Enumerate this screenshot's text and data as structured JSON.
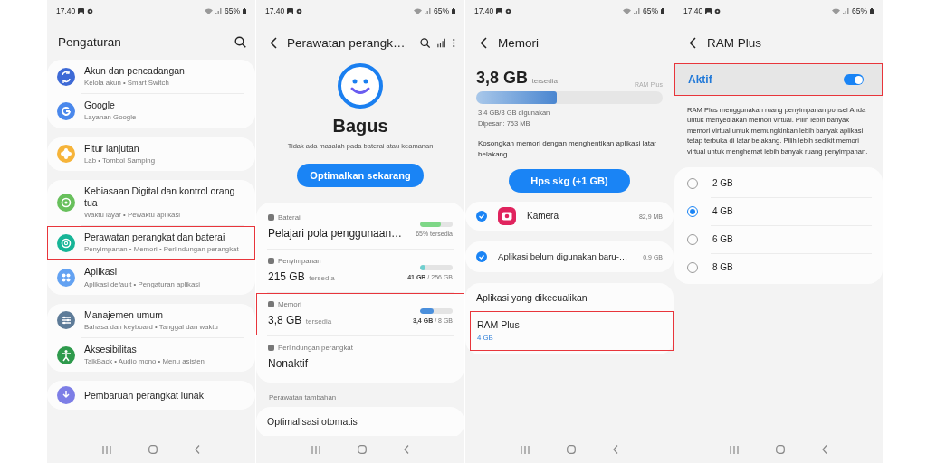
{
  "screens": [
    {
      "kind": "settings",
      "status_bar": {
        "time": "17.40",
        "battery": "65%"
      },
      "title": "Pengaturan",
      "groups": [
        {
          "items": [
            {
              "title": "Akun dan pencadangan",
              "subtitle": "Kelola akun • Smart Switch",
              "color": "#3e6ad6",
              "highlighted": false
            },
            {
              "title": "Google",
              "subtitle": "Layanan Google",
              "color": "#4a88ec",
              "highlighted": false
            }
          ]
        },
        {
          "items": [
            {
              "title": "Fitur lanjutan",
              "subtitle": "Lab • Tombol Samping",
              "color": "#f6b43a",
              "highlighted": false
            }
          ]
        },
        {
          "items": [
            {
              "title": "Kebiasaan Digital dan kontrol orang tua",
              "subtitle": "Waktu layar • Pewaktu aplikasi",
              "color": "#68c05c",
              "highlighted": false
            },
            {
              "title": "Perawatan perangkat dan baterai",
              "subtitle": "Penyimpanan • Memori • Perlindungan perangkat",
              "color": "#17b597",
              "highlighted": true
            },
            {
              "title": "Aplikasi",
              "subtitle": "Aplikasi default • Pengaturan aplikasi",
              "color": "#63a2f2",
              "highlighted": false
            }
          ]
        },
        {
          "items": [
            {
              "title": "Manajemen umum",
              "subtitle": "Bahasa dan keyboard • Tanggal dan waktu",
              "color": "#5d7b98",
              "highlighted": false
            },
            {
              "title": "Aksesibilitas",
              "subtitle": "TalkBack • Audio mono • Menu asisten",
              "color": "#2e9a4c",
              "highlighted": false
            }
          ]
        },
        {
          "items": [
            {
              "title": "Pembaruan perangkat lunak",
              "color": "#7d7ee6",
              "highlighted": false
            }
          ]
        }
      ]
    },
    {
      "kind": "care",
      "status_bar": {
        "time": "17.40",
        "battery": "65%"
      },
      "title": "Perawatan perangk…",
      "status": "Bagus",
      "description": "Tidak ada masalah pada baterai atau keamanan",
      "button": "Optimalkan sekarang",
      "items": [
        {
          "label": "Baterai",
          "value": "Pelajari pola penggunaan…",
          "level": 0.65,
          "color": "#7ed787",
          "caption": "65% tersedia",
          "highlighted": false
        },
        {
          "label": "Penyimpanan",
          "value": "215 GB",
          "unit": "tersedia",
          "level": 0.17,
          "color": "#6fcfcf",
          "caption": "**41 GB** / 256 GB",
          "highlighted": false
        },
        {
          "label": "Memori",
          "value": "3,8 GB",
          "unit": "tersedia",
          "level": 0.43,
          "color": "#4a8fdc",
          "caption": "**3,4 GB** / 8 GB",
          "highlighted": true
        },
        {
          "label": "Perlindungan perangkat",
          "value": "Nonaktif",
          "highlighted": false
        }
      ],
      "section": "Perawatan tambahan",
      "more_item": "Optimalisasi otomatis"
    },
    {
      "kind": "memory",
      "status_bar": {
        "time": "17.40",
        "battery": "65%"
      },
      "title": "Memori",
      "available": "3,8 GB",
      "available_unit": "tersedia",
      "ram_plus_label": "RAM Plus",
      "level": 0.43,
      "used": "3,4 GB/8 GB digunakan",
      "reserved": "Dipesan: 753 MB",
      "description": "Kosongkan memori dengan menghentikan aplikasi latar belakang.",
      "button": "Hps skg (+1 GB)",
      "apps": [
        {
          "kind": "app",
          "name": "Kamera",
          "size": "82,9 MB",
          "checked": true
        },
        {
          "kind": "group",
          "name": "Aplikasi belum digunakan baru-…",
          "size": "0,9 GB",
          "checked": true
        }
      ],
      "excluded_header": "Aplikasi yang dikecualikan",
      "excluded": {
        "title": "RAM Plus",
        "subtitle": "4 GB",
        "highlighted": true
      }
    },
    {
      "kind": "ramplus",
      "status_bar": {
        "time": "17.40",
        "battery": "65%"
      },
      "title": "RAM Plus",
      "toggle": {
        "label": "Aktif",
        "on": true,
        "highlighted": true
      },
      "description": "RAM Plus menggunakan ruang penyimpanan ponsel Anda untuk menyediakan memori virtual. Pilih lebih banyak memori virtual untuk memungkinkan lebih banyak aplikasi tetap terbuka di latar belakang. Pilih lebih sedikit memori virtual untuk menghemat lebih banyak ruang penyimpanan.",
      "options": [
        {
          "label": "2 GB",
          "selected": false
        },
        {
          "label": "4 GB",
          "selected": true
        },
        {
          "label": "6 GB",
          "selected": false
        },
        {
          "label": "8 GB",
          "selected": false
        }
      ]
    }
  ]
}
